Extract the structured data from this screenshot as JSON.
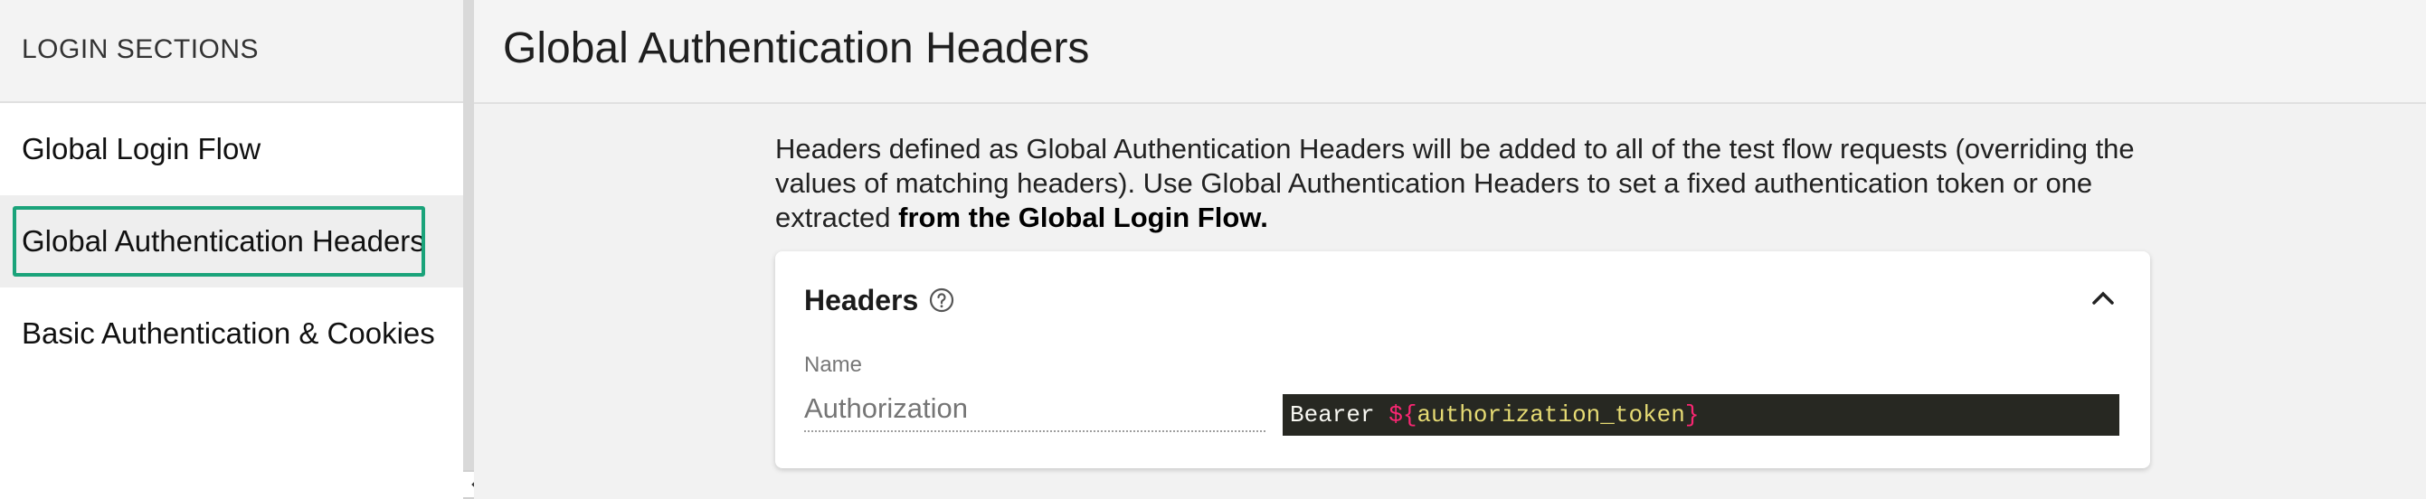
{
  "sidebar": {
    "header": "LOGIN SECTIONS",
    "items": [
      {
        "label": "Global Login Flow",
        "selected": false
      },
      {
        "label": "Global Authentication Headers",
        "selected": true
      },
      {
        "label": "Basic Authentication & Cookies",
        "selected": false
      }
    ]
  },
  "main": {
    "title": "Global Authentication Headers",
    "description": "Headers defined as Global Authentication Headers will be added to all of the test flow requests (overriding the values of matching headers). Use Global Authentication Headers to set a fixed authentication token or one extracted ",
    "description_bold": "from the Global Login Flow.",
    "headers_card": {
      "title": "Headers",
      "name_label": "Name",
      "name_placeholder": "Authorization",
      "value_prefix": "Bearer ",
      "value_var_open": "${",
      "value_var_name": "authorization_token",
      "value_var_close": "}"
    }
  },
  "colors": {
    "selected_outline": "#1aa37a",
    "code_background": "#272822"
  },
  "icons": [
    "help-circle-icon",
    "chevron-up-icon",
    "chevron-left-icon"
  ]
}
